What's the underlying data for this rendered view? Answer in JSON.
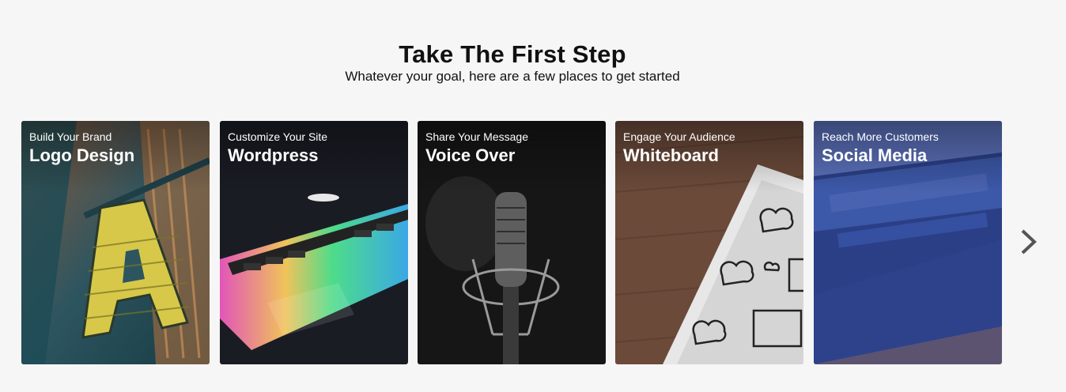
{
  "section": {
    "title": "Take The First Step",
    "subtitle": "Whatever your goal, here are a few places to get started"
  },
  "cards": [
    {
      "kicker": "Build Your Brand",
      "name": "Logo Design"
    },
    {
      "kicker": "Customize Your Site",
      "name": "Wordpress"
    },
    {
      "kicker": "Share Your Message",
      "name": "Voice Over"
    },
    {
      "kicker": "Engage Your Audience",
      "name": "Whiteboard"
    },
    {
      "kicker": "Reach More Customers",
      "name": "Social Media"
    }
  ],
  "icons": {
    "next": "chevron-right-icon"
  },
  "colors": {
    "background": "#f6f6f6",
    "title": "#111111",
    "card_text": "#ffffff",
    "arrow": "#555555"
  }
}
